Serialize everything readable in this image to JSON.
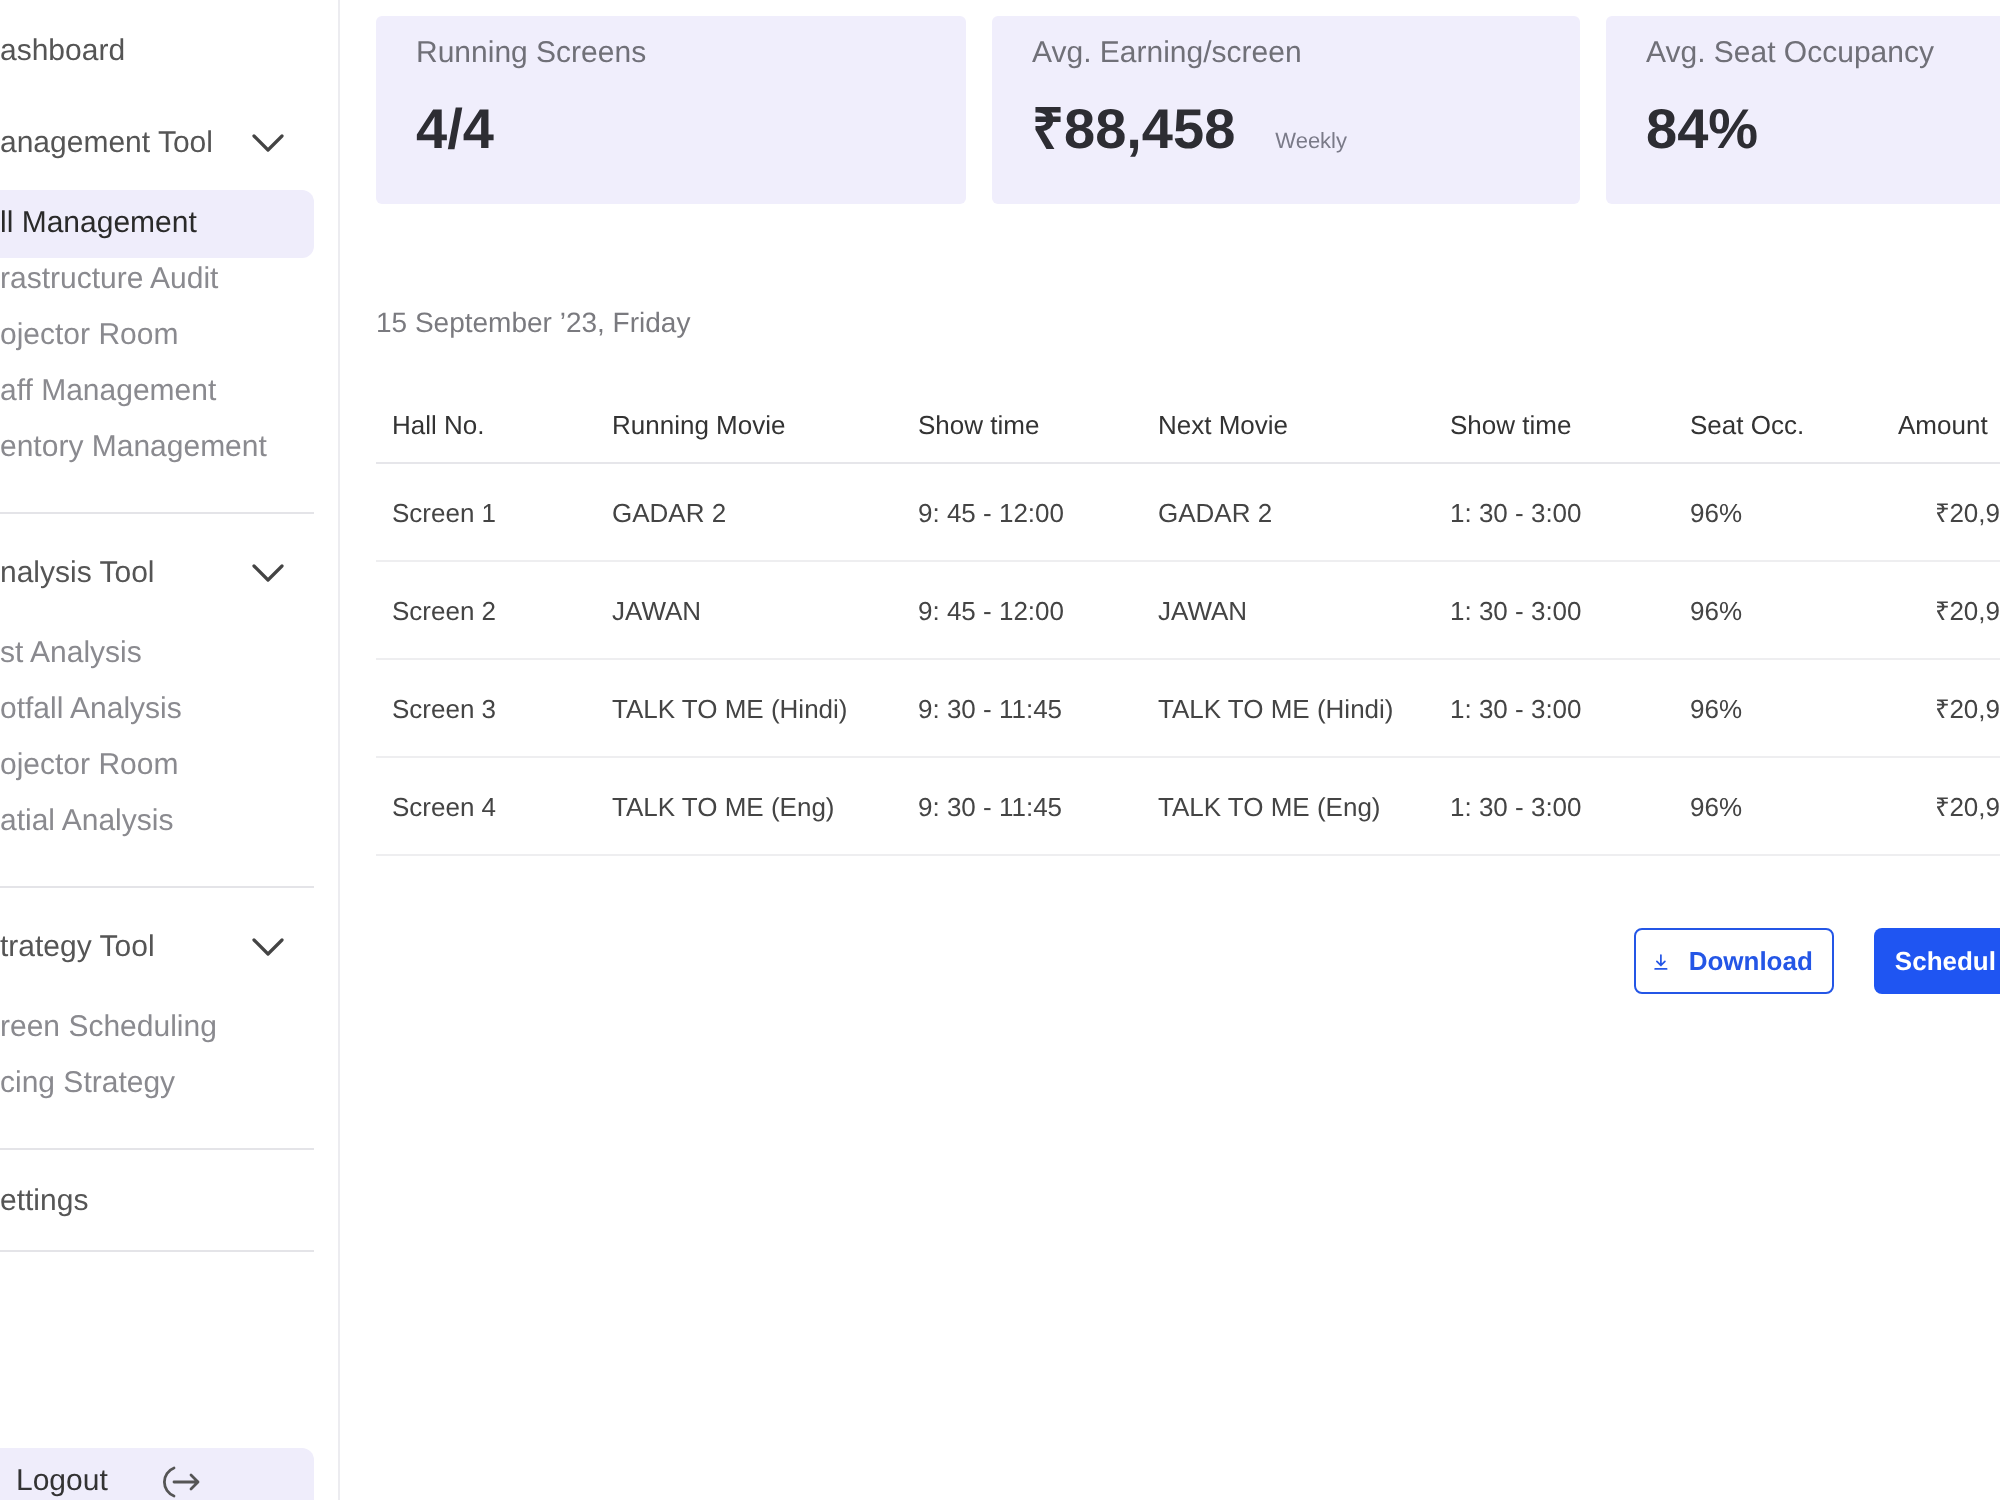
{
  "sidebar": {
    "items": [
      {
        "kind": "link",
        "label": "ashboard",
        "selected": false
      },
      {
        "kind": "group",
        "label": "anagement Tool",
        "expanded": true,
        "children": [
          {
            "label": "ll Management",
            "selected": true
          },
          {
            "label": "rastructure Audit",
            "selected": false
          },
          {
            "label": "ojector Room",
            "selected": false
          },
          {
            "label": "aff Management",
            "selected": false
          },
          {
            "label": "entory Management",
            "selected": false
          }
        ]
      },
      {
        "kind": "group",
        "label": "nalysis Tool",
        "expanded": true,
        "children": [
          {
            "label": "st Analysis",
            "selected": false
          },
          {
            "label": "otfall Analysis",
            "selected": false
          },
          {
            "label": "ojector Room",
            "selected": false
          },
          {
            "label": "atial Analysis",
            "selected": false
          }
        ]
      },
      {
        "kind": "group",
        "label": "trategy Tool",
        "expanded": true,
        "children": [
          {
            "label": "reen Scheduling",
            "selected": false
          },
          {
            "label": "cing Strategy",
            "selected": false
          }
        ]
      },
      {
        "kind": "link",
        "label": "ettings",
        "selected": false
      }
    ],
    "logout": {
      "label": "Logout"
    }
  },
  "stats": [
    {
      "label": "Running Screens",
      "value": "4/4"
    },
    {
      "label": "Avg. Earning/screen",
      "value": "₹88,458",
      "note": "Weekly"
    },
    {
      "label": "Avg. Seat Occupancy",
      "value": "84%"
    }
  ],
  "date": "15 September ’23, Friday",
  "table": {
    "columns": [
      "Hall No.",
      "Running Movie",
      "Show time",
      "Next Movie",
      "Show time",
      "Seat Occ.",
      "Amount"
    ],
    "rows": [
      [
        "Screen 1",
        "GADAR 2",
        "9: 45 - 12:00",
        "GADAR 2",
        "1: 30 - 3:00",
        "96%",
        "₹20,9"
      ],
      [
        "Screen 2",
        "JAWAN",
        "9: 45 - 12:00",
        "JAWAN",
        "1: 30 - 3:00",
        "96%",
        "₹20,9"
      ],
      [
        "Screen 3",
        "TALK TO ME (Hindi)",
        "9: 30 - 11:45",
        "TALK TO ME (Hindi)",
        "1: 30 - 3:00",
        "96%",
        "₹20,9"
      ],
      [
        "Screen 4",
        "TALK TO ME (Eng)",
        "9: 30 - 11:45",
        "TALK TO ME (Eng)",
        "1: 30 - 3:00",
        "96%",
        "₹20,9"
      ]
    ]
  },
  "buttons": [
    {
      "kind": "outline",
      "label": "Download"
    },
    {
      "kind": "filled",
      "label": "Schedul"
    }
  ]
}
